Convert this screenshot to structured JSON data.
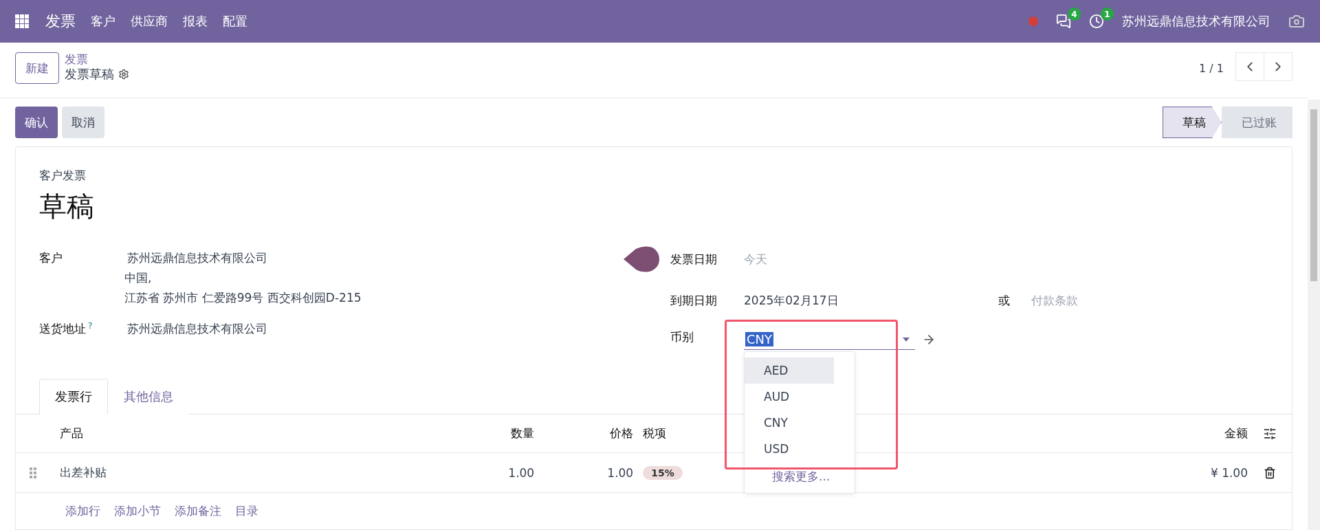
{
  "navbar": {
    "app": "发票",
    "menu": [
      "客户",
      "供应商",
      "报表",
      "配置"
    ],
    "messages_count": "4",
    "activities_count": "1",
    "company": "苏州远鼎信息技术有限公司"
  },
  "control_panel": {
    "new_button": "新建",
    "breadcrumb": "发票",
    "record": "发票草稿",
    "pager": "1 / 1"
  },
  "actions": [
    {
      "label": "确认",
      "kind": "primary"
    },
    {
      "label": "取消",
      "kind": "secondary"
    }
  ],
  "status_steps": [
    {
      "label": "草稿",
      "selected": true
    },
    {
      "label": "已过账",
      "selected": false
    }
  ],
  "form": {
    "subtitle": "客户发票",
    "title": "草稿",
    "customer": {
      "label": "客户",
      "name": "苏州远鼎信息技术有限公司",
      "address": [
        "中国,",
        "江苏省 苏州市 仁爱路99号 西交科创园D-215"
      ]
    },
    "delivery": {
      "label": "送货地址",
      "help": "?",
      "value": "苏州远鼎信息技术有限公司"
    },
    "invoice_date": {
      "label": "发票日期",
      "placeholder": "今天"
    },
    "due_date": {
      "label": "到期日期",
      "value": "2025年02月17日",
      "or": "或",
      "terms_placeholder": "付款条款"
    },
    "currency": {
      "label": "币别",
      "value": "CNY",
      "options": [
        {
          "label": "AED",
          "highlighted": true
        },
        {
          "label": "AUD",
          "highlighted": false
        },
        {
          "label": "CNY",
          "highlighted": false
        },
        {
          "label": "USD",
          "highlighted": false
        }
      ],
      "search_more": "搜索更多..."
    }
  },
  "tabs": [
    {
      "label": "发票行",
      "selected": true
    },
    {
      "label": "其他信息",
      "selected": false
    }
  ],
  "table": {
    "columns": [
      "产品",
      "数量",
      "价格",
      "税项",
      "金额"
    ],
    "rows": [
      {
        "product": "出差补贴",
        "quantity": "1.00",
        "price": "1.00",
        "taxes": [
          "15%"
        ],
        "amount": "¥ 1.00"
      }
    ],
    "add_links": [
      "添加行",
      "添加小节",
      "添加备注",
      "目录"
    ]
  }
}
